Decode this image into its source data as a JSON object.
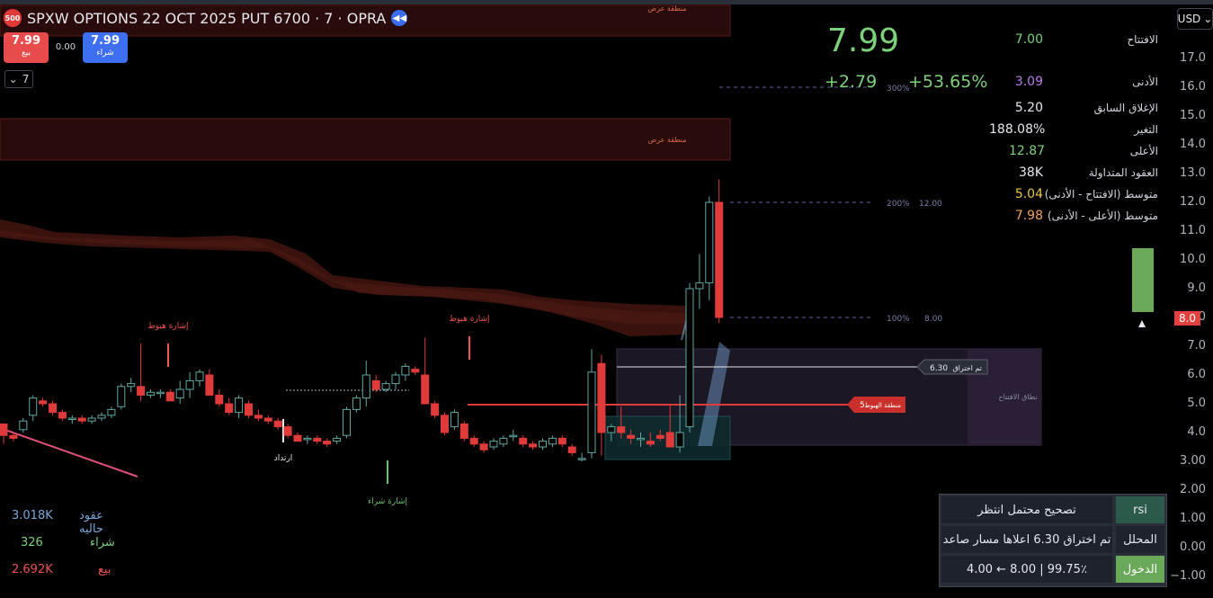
{
  "header": {
    "logo_text": "500",
    "symbol": "SPXW OPTIONS 22 OCT 2025 PUT 6700 · 7 · OPRA",
    "sell_price": "7.99",
    "sell_label": "بيع",
    "buy_price": "7.99",
    "buy_label": "شراء",
    "spread": "0.00",
    "interval": "7"
  },
  "currency": "USD",
  "quote": {
    "last": "7.99",
    "change": "+2.79",
    "change_percent": "+53.65%"
  },
  "stats": [
    {
      "label": "الافتتاح",
      "value": "7.00",
      "color": "#7cd17a"
    },
    {
      "label": "الأدنى",
      "value": "3.09",
      "color": "#b57be6"
    },
    {
      "label": "الإغلاق السابق",
      "value": "5.20",
      "color": "#e6e8ee"
    },
    {
      "label": "التغير",
      "value": "188.08%",
      "color": "#e6e8ee"
    },
    {
      "label": "الأعلى",
      "value": "12.87",
      "color": "#7cd17a"
    },
    {
      "label": "العقود المتداولة",
      "value": "38K",
      "color": "#e6e8ee"
    },
    {
      "label": "متوسط (الافتتاح - الأدنى)",
      "value": "5.04",
      "color": "#e6c84a"
    },
    {
      "label": "متوسط (الأعلى - الأدنى)",
      "value": "7.98",
      "color": "#f0a35b"
    }
  ],
  "price_axis": [
    "17.0",
    "16.0",
    "15.0",
    "14.0",
    "13.0",
    "12.0",
    "11.0",
    "10.0",
    "9.0",
    "8.0",
    "7.0",
    "6.0",
    "5.0",
    "4.0",
    "3.00",
    "2.00",
    "1.00",
    "0.00",
    "−1.00"
  ],
  "current_price_tag": "8.0",
  "zones": {
    "supply1": "منطقة عرض",
    "supply2": "منطقة عرض",
    "open_range": "نطاق الافتتاح"
  },
  "signals": {
    "sell1": "إشارة هبوط",
    "sell2": "إشارة هبوط",
    "buy": "إشارة شراء",
    "bounce": "ارتداد"
  },
  "targets": [
    {
      "pct": "300%",
      "price": "16.00"
    },
    {
      "pct": "200%",
      "price": "12.00"
    },
    {
      "pct": "100%",
      "price": "8.00"
    }
  ],
  "breakout_tag": {
    "label": "تم اختراق",
    "price": "6.30"
  },
  "downside_tag": {
    "label": "منطقة الهبوط",
    "price": "5"
  },
  "volume": [
    {
      "label": "عقود حاليه",
      "value": "3.018K",
      "color": "#7aa7d8"
    },
    {
      "label": "شراء",
      "value": "326",
      "color": "#7cd17a"
    },
    {
      "label": "بيع",
      "value": "2.692K",
      "color": "#ef5350"
    }
  ],
  "panel": {
    "rsi_label": "rsi",
    "rsi_text": "تصحيح محتمل انتظر",
    "analyst_label": "المحلل",
    "analyst_text": "تم اختراق 6.30 اعلاها مسار صاعد",
    "entry_label": "الدخول",
    "entry_text": "4.00 ← 8.00 | 99.75٪"
  },
  "colors": {
    "up": "#7cd17a",
    "down": "#ef5350",
    "accent": "#3f6ff1"
  },
  "chart_data": {
    "type": "candlestick",
    "y_range": [
      -1,
      17
    ],
    "candles": [
      [
        4.3,
        4.0,
        3.6,
        3.9
      ],
      [
        3.9,
        4.0,
        3.7,
        3.8
      ],
      [
        4.1,
        4.5,
        4.0,
        4.4
      ],
      [
        4.6,
        5.3,
        4.4,
        5.2
      ],
      [
        5.1,
        5.2,
        4.9,
        5.0
      ],
      [
        5.0,
        5.1,
        4.6,
        4.7
      ],
      [
        4.7,
        4.8,
        4.4,
        4.5
      ],
      [
        4.5,
        4.6,
        4.3,
        4.5
      ],
      [
        4.5,
        4.6,
        4.3,
        4.4
      ],
      [
        4.4,
        4.6,
        4.3,
        4.5
      ],
      [
        4.5,
        4.7,
        4.4,
        4.6
      ],
      [
        4.6,
        4.9,
        4.5,
        4.8
      ],
      [
        4.9,
        5.7,
        4.8,
        5.6
      ],
      [
        5.6,
        5.9,
        5.4,
        5.7
      ],
      [
        5.6,
        7.1,
        5.1,
        5.3
      ],
      [
        5.3,
        5.5,
        5.2,
        5.4
      ],
      [
        5.4,
        5.5,
        5.2,
        5.4
      ],
      [
        5.4,
        5.5,
        5.1,
        5.1
      ],
      [
        5.2,
        5.8,
        5.0,
        5.5
      ],
      [
        5.5,
        6.1,
        5.2,
        5.8
      ],
      [
        5.8,
        6.2,
        5.6,
        6.1
      ],
      [
        6.0,
        6.2,
        5.3,
        5.3
      ],
      [
        5.3,
        5.5,
        4.9,
        5.0
      ],
      [
        5.0,
        5.2,
        4.6,
        4.7
      ],
      [
        4.7,
        5.3,
        4.5,
        5.2
      ],
      [
        5.0,
        5.1,
        4.5,
        4.6
      ],
      [
        4.6,
        4.8,
        4.4,
        4.5
      ],
      [
        4.5,
        4.6,
        4.3,
        4.4
      ],
      [
        4.4,
        4.5,
        4.1,
        4.2
      ],
      [
        4.2,
        4.3,
        3.8,
        3.9
      ],
      [
        3.9,
        4.0,
        3.7,
        3.7
      ],
      [
        3.8,
        3.9,
        3.6,
        3.8
      ],
      [
        3.8,
        3.9,
        3.6,
        3.7
      ],
      [
        3.7,
        3.8,
        3.5,
        3.6
      ],
      [
        3.7,
        3.9,
        3.6,
        3.8
      ],
      [
        3.9,
        4.9,
        3.8,
        4.8
      ],
      [
        4.8,
        5.3,
        4.7,
        5.2
      ],
      [
        5.2,
        6.5,
        4.9,
        6.0
      ],
      [
        5.8,
        6.0,
        5.4,
        5.5
      ],
      [
        5.5,
        5.8,
        5.4,
        5.7
      ],
      [
        5.7,
        6.1,
        5.5,
        6.0
      ],
      [
        6.0,
        6.4,
        5.8,
        6.3
      ],
      [
        6.2,
        6.3,
        6.0,
        6.1
      ],
      [
        6.0,
        7.3,
        5.7,
        5.0
      ],
      [
        5.0,
        5.1,
        4.5,
        4.6
      ],
      [
        4.6,
        4.7,
        3.9,
        4.0
      ],
      [
        4.2,
        4.8,
        4.1,
        4.7
      ],
      [
        4.3,
        4.4,
        3.7,
        3.8
      ],
      [
        3.8,
        3.9,
        3.5,
        3.6
      ],
      [
        3.6,
        3.7,
        3.3,
        3.4
      ],
      [
        3.5,
        3.8,
        3.4,
        3.7
      ],
      [
        3.6,
        3.9,
        3.5,
        3.8
      ],
      [
        3.9,
        4.1,
        3.7,
        3.9
      ],
      [
        3.8,
        3.9,
        3.5,
        3.6
      ],
      [
        3.6,
        3.7,
        3.4,
        3.5
      ],
      [
        3.5,
        3.8,
        3.4,
        3.7
      ],
      [
        3.6,
        3.9,
        3.5,
        3.8
      ],
      [
        3.8,
        3.9,
        3.5,
        3.6
      ],
      [
        3.5,
        3.6,
        3.2,
        3.3
      ],
      [
        3.1,
        3.3,
        3.0,
        3.1
      ],
      [
        3.3,
        6.9,
        3.1,
        6.1
      ],
      [
        6.4,
        6.7,
        3.2,
        4.0
      ],
      [
        4.0,
        4.3,
        3.7,
        4.2
      ],
      [
        4.2,
        4.9,
        3.8,
        4.0
      ],
      [
        3.9,
        4.1,
        3.6,
        3.8
      ],
      [
        3.8,
        4.0,
        3.5,
        3.8
      ],
      [
        3.7,
        4.0,
        3.5,
        3.6
      ],
      [
        3.9,
        4.1,
        3.7,
        3.8
      ],
      [
        4.0,
        5.0,
        3.5,
        3.5
      ],
      [
        3.5,
        5.3,
        3.3,
        4.0
      ],
      [
        4.2,
        9.2,
        4.0,
        9.0
      ],
      [
        9.0,
        10.2,
        8.3,
        9.2
      ],
      [
        9.2,
        12.2,
        8.6,
        12.0
      ],
      [
        12.0,
        12.8,
        7.8,
        8.0
      ]
    ]
  }
}
